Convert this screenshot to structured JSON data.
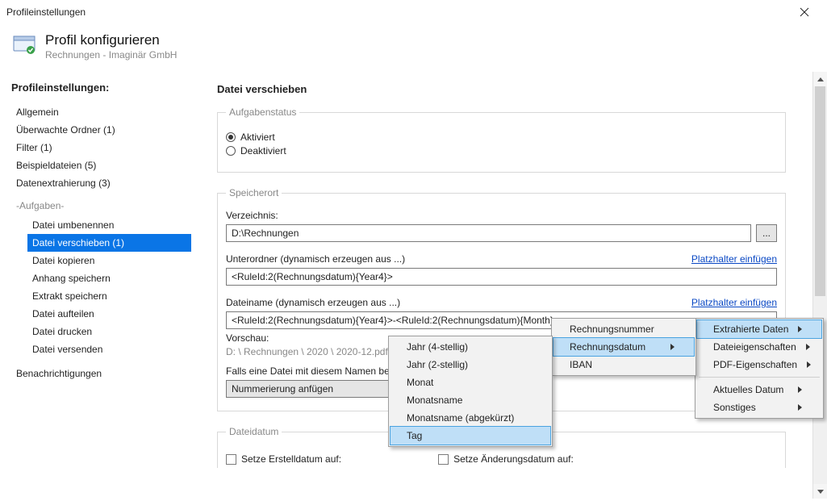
{
  "window": {
    "title": "Profileinstellungen"
  },
  "header": {
    "title": "Profil konfigurieren",
    "subtitle": "Rechnungen - Imaginär GmbH"
  },
  "sidebar": {
    "title": "Profileinstellungen:",
    "items": [
      "Allgemein",
      "Überwachte Ordner (1)",
      "Filter (1)",
      "Beispieldateien (5)",
      "Datenextrahierung (3)"
    ],
    "tasks_header": "-Aufgaben-",
    "tasks": [
      "Datei umbenennen",
      "Datei verschieben (1)",
      "Datei kopieren",
      "Anhang speichern",
      "Extrakt speichern",
      "Datei aufteilen",
      "Datei drucken",
      "Datei versenden"
    ],
    "notifications_label": "Benachrichtigungen"
  },
  "main": {
    "title": "Datei verschieben",
    "status": {
      "legend": "Aufgabenstatus",
      "activated": "Aktiviert",
      "deactivated": "Deaktiviert"
    },
    "location": {
      "legend": "Speicherort",
      "dir_label": "Verzeichnis:",
      "dir_value": "D:\\Rechnungen",
      "browse_btn": "...",
      "subfolder_label": "Unterordner (dynamisch erzeugen aus ...)",
      "subfolder_value": "<RuleId:2(Rechnungsdatum){Year4}>",
      "insert_placeholder": "Platzhalter einfügen",
      "filename_label": "Dateiname (dynamisch erzeugen aus ...)",
      "filename_value": "<RuleId:2(Rechnungsdatum){Year4}>-<RuleId:2(Rechnungsdatum){Month}>",
      "preview_label": "Vorschau:",
      "preview_value": "D: \\ Rechnungen \\ 2020 \\ 2020-12.pdf",
      "exists_label": "Falls eine Datei mit diesem Namen bereits existiert:",
      "exists_value": "Nummerierung anfügen"
    },
    "filedate": {
      "legend": "Dateidatum",
      "set_created": "Setze Erstelldatum auf:",
      "set_modified": "Setze Änderungsdatum auf:"
    }
  },
  "menus": {
    "m1": [
      "Extrahierte Daten",
      "Dateieigenschaften",
      "PDF-Eigenschaften",
      "Aktuelles Datum",
      "Sonstiges"
    ],
    "m2": [
      "Rechnungsnummer",
      "Rechnungsdatum",
      "IBAN"
    ],
    "m3": [
      "Jahr (4-stellig)",
      "Jahr (2-stellig)",
      "Monat",
      "Monatsname",
      "Monatsname (abgekürzt)",
      "Tag"
    ]
  }
}
